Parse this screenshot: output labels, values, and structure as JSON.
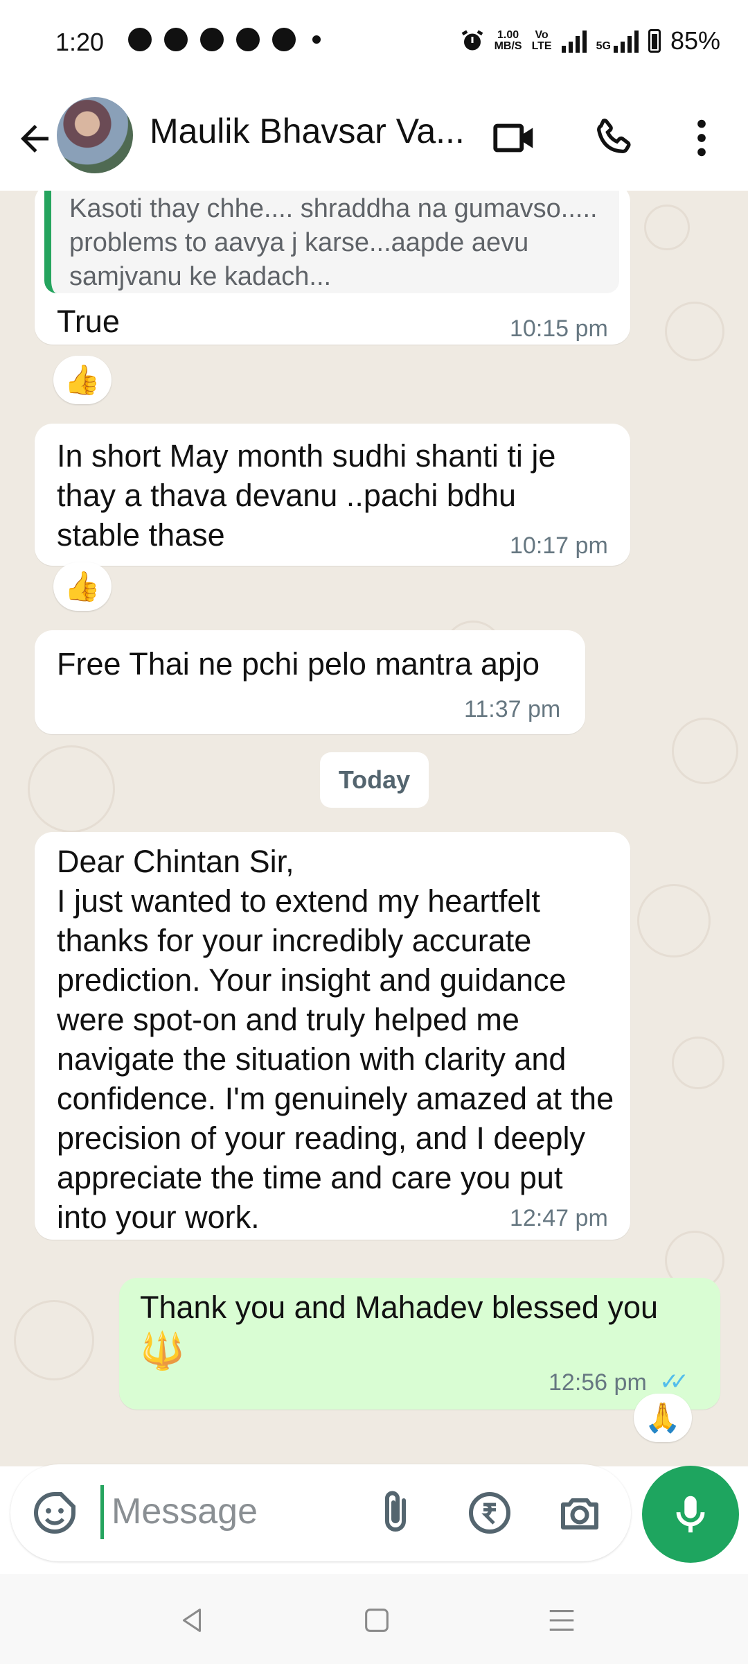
{
  "status_bar": {
    "time": "1:20",
    "net_speed_value": "1.00",
    "net_speed_unit": "MB/S",
    "volte_top": "Vo",
    "volte_bottom": "LTE",
    "network": "5G",
    "battery": "85%"
  },
  "header": {
    "contact_name": "Maulik Bhavsar Va...",
    "icons": [
      "back-arrow-icon",
      "video-call-icon",
      "phone-call-icon",
      "more-options-icon"
    ]
  },
  "messages": [
    {
      "quote": "Kasoti thay chhe.... shraddha na gumavso..... problems to aavya j karse...aapde aevu samjvanu ke kadach...",
      "text": "True",
      "time": "10:15 pm",
      "reaction": "👍"
    },
    {
      "text": "In short May month sudhi shanti ti je thay a thava devanu ..pachi bdhu stable thase",
      "time": "10:17 pm",
      "reaction": "👍"
    },
    {
      "text": "Free Thai ne pchi pelo mantra apjo",
      "time": "11:37 pm"
    },
    {
      "text": "Dear Chintan Sir,\nI just wanted to extend my heartfelt thanks for your incredibly accurate prediction. Your insight and guidance were spot-on and truly helped me navigate the situation with clarity and confidence. I'm genuinely amazed at the precision of your reading, and I deeply appreciate the time and care you put into your work.",
      "time": "12:47 pm"
    },
    {
      "text": "Thank you and Mahadev blessed you",
      "emoji": "🔱",
      "time": "12:56 pm",
      "ticks": "✓✓",
      "reaction": "🙏"
    }
  ],
  "day_separator": "Today",
  "input": {
    "placeholder": "Message",
    "icons": [
      "sticker-icon",
      "attach-icon",
      "rupee-payment-icon",
      "camera-icon",
      "mic-icon"
    ]
  },
  "colors": {
    "chat_bg": "#efeae2",
    "outgoing_bubble": "#d9fdd3",
    "accent_green": "#1ea55f",
    "read_ticks": "#53bdeb"
  }
}
